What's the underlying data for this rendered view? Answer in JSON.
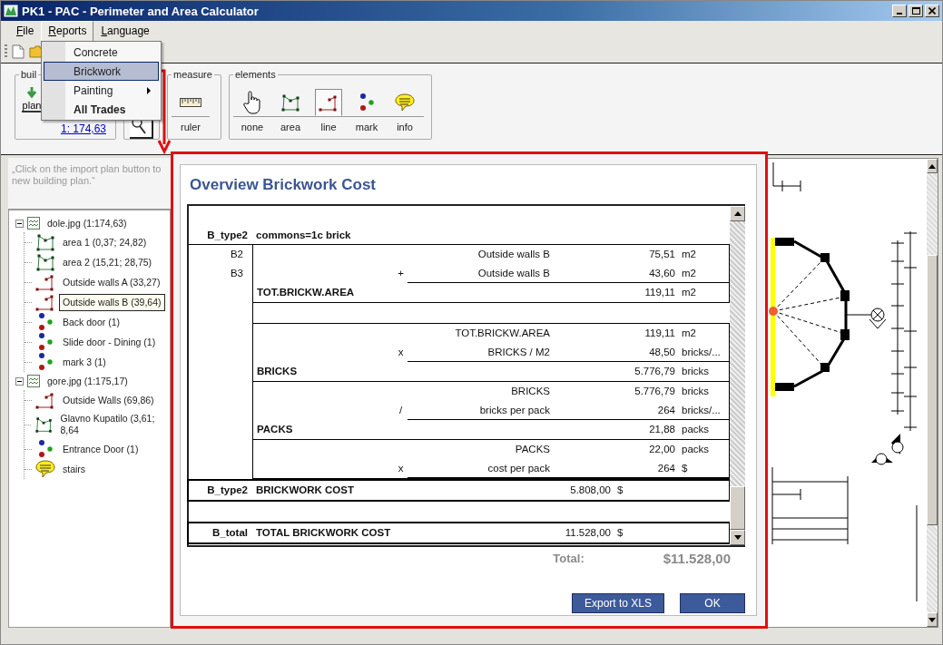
{
  "window": {
    "title": "PK1 - PAC - Perimeter and Area Calculator"
  },
  "menu_bar": [
    {
      "label": "File",
      "selected": false
    },
    {
      "label": "Reports",
      "selected": true
    },
    {
      "label": "Language",
      "selected": false
    }
  ],
  "reports_menu": [
    {
      "label": "Concrete",
      "selected": false,
      "submenu": false,
      "emphasized": false
    },
    {
      "label": "Brickwork",
      "selected": true,
      "submenu": false,
      "emphasized": false
    },
    {
      "label": "Painting",
      "selected": false,
      "submenu": true,
      "emphasized": false
    },
    {
      "label": "All Trades",
      "selected": false,
      "submenu": false,
      "emphasized": true
    }
  ],
  "ribbon": {
    "building_plan": {
      "label": "buil",
      "button_label": "plan",
      "scale_link": "1: 174,63"
    },
    "measure": {
      "label": "measure",
      "tools": [
        {
          "kind": "ruler",
          "label": "ruler",
          "selected": false
        }
      ]
    },
    "elements": {
      "label": "elements",
      "tools": [
        {
          "kind": "pointer",
          "label": "none",
          "selected": false
        },
        {
          "kind": "area",
          "label": "area",
          "selected": false
        },
        {
          "kind": "line",
          "label": "line",
          "selected": true
        },
        {
          "kind": "mark",
          "label": "mark",
          "selected": false
        },
        {
          "kind": "info",
          "label": "info",
          "selected": false
        }
      ]
    }
  },
  "hint": {
    "text": "„Click on the import plan button to new building plan.“"
  },
  "tree": [
    {
      "kind": "image",
      "label": "dole.jpg (1:174,63)",
      "expanded": true,
      "selected": false,
      "children": [
        {
          "kind": "area",
          "label": "area 1 (0,37; 24,82)",
          "selected": false
        },
        {
          "kind": "area",
          "label": "area 2 (15,21; 28,75)",
          "selected": false
        },
        {
          "kind": "line",
          "label": "Outside walls A (33,27)",
          "selected": false
        },
        {
          "kind": "line",
          "label": "Outside walls B (39,64)",
          "selected": true
        },
        {
          "kind": "mark",
          "label": "Back door (1)",
          "selected": false
        },
        {
          "kind": "mark",
          "label": "Slide door - Dining (1)",
          "selected": false
        },
        {
          "kind": "mark",
          "label": "mark 3 (1)",
          "selected": false
        }
      ]
    },
    {
      "kind": "image",
      "label": "gore.jpg (1:175,17)",
      "expanded": true,
      "selected": false,
      "children": [
        {
          "kind": "line",
          "label": "Outside Walls (69,86)",
          "selected": false
        },
        {
          "kind": "area",
          "label": "Glavno Kupatilo (3,61; 8,64",
          "selected": false
        },
        {
          "kind": "mark",
          "label": "Entrance Door (1)",
          "selected": false
        },
        {
          "kind": "info",
          "label": "stairs",
          "selected": false
        }
      ]
    }
  ],
  "report": {
    "title": "Overview Brickwork Cost",
    "sections": [
      {
        "code": "B_type2",
        "title": "commons=1c brick",
        "groups": [
          [
            {
              "lines": [
                {
                  "code": "B2",
                  "label": "Outside walls B",
                  "value": "75,51",
                  "unit": "m2"
                },
                {
                  "code": "B3",
                  "op": "+",
                  "label": "Outside walls B",
                  "value": "43,60",
                  "unit": "m2"
                }
              ],
              "result": {
                "label": "TOT.BRICKW.AREA",
                "value": "119,11",
                "unit": "m2"
              }
            }
          ],
          [
            {
              "lines": [
                {
                  "label": "TOT.BRICKW.AREA",
                  "value": "119,11",
                  "unit": "m2"
                },
                {
                  "op": "x",
                  "label": "BRICKS / M2",
                  "value": "48,50",
                  "unit": "bricks/..."
                }
              ],
              "result": {
                "label": "BRICKS",
                "value": "5.776,79",
                "unit": "bricks"
              }
            },
            {
              "lines": [
                {
                  "label": "BRICKS",
                  "value": "5.776,79",
                  "unit": "bricks"
                },
                {
                  "op": "/",
                  "label": "bricks per pack",
                  "value": "264",
                  "unit": "bricks/..."
                }
              ],
              "result": {
                "label": "PACKS",
                "value": "21,88",
                "unit": "packs"
              }
            },
            {
              "lines": [
                {
                  "label": "PACKS",
                  "value": "22,00",
                  "unit": "packs"
                },
                {
                  "op": "x",
                  "label": "cost per pack",
                  "value": "264",
                  "unit": "$"
                }
              ]
            }
          ]
        ],
        "subtotal": {
          "code": "B_type2",
          "label": "BRICKWORK COST",
          "value": "5.808,00",
          "unit": "$"
        }
      }
    ],
    "total": {
      "code": "B_total",
      "label": "TOTAL BRICKWORK COST",
      "value": "11.528,00",
      "unit": "$"
    },
    "grand_total": {
      "label": "Total:",
      "value": "$11.528,00"
    },
    "buttons": [
      {
        "label": "Export to XLS"
      },
      {
        "label": "OK"
      }
    ]
  }
}
